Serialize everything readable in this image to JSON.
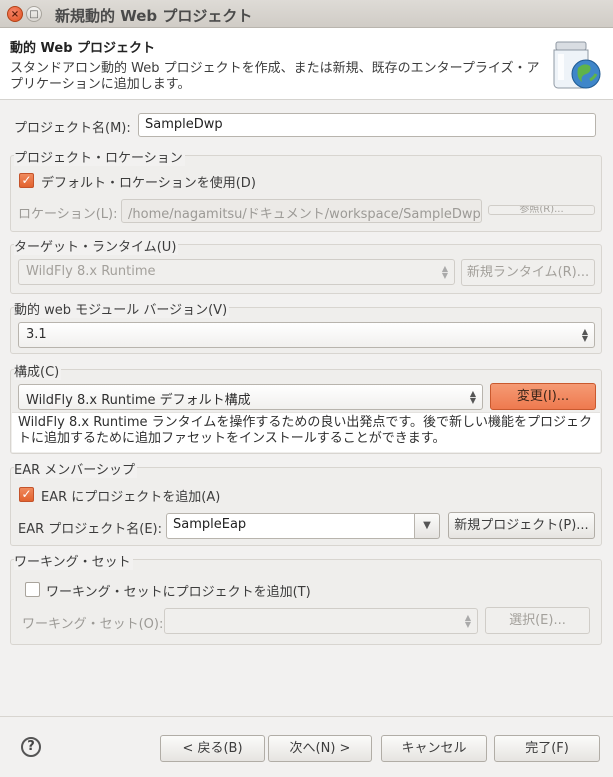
{
  "window": {
    "title": "新規動的 Web プロジェクト",
    "close_glyph": "×",
    "max_glyph": "□"
  },
  "banner": {
    "title": "動的 Web プロジェクト",
    "description": "スタンドアロン動的 Web プロジェクトを作成、または新規、既存のエンタープライズ・アプリケーションに追加します。",
    "icon": "web-project-jar-globe-icon"
  },
  "project_name": {
    "label": "プロジェクト名(M):",
    "value": "SampleDwp"
  },
  "location": {
    "group_title": "プロジェクト・ロケーション",
    "use_default_label": "デフォルト・ロケーションを使用(D)",
    "use_default_checked": true,
    "location_label": "ロケーション(L):",
    "location_value": "/home/nagamitsu/ドキュメント/workspace/SampleDwp",
    "browse_label": "参照(R)..."
  },
  "target_runtime": {
    "group_title": "ターゲット・ランタイム(U)",
    "selected": "WildFly 8.x Runtime",
    "new_runtime_label": "新規ランタイム(R)..."
  },
  "module_version": {
    "group_title": "動的 web モジュール バージョン(V)",
    "selected": "3.1"
  },
  "configuration": {
    "group_title": "構成(C)",
    "selected": "WildFly 8.x Runtime デフォルト構成",
    "modify_label": "変更(I)...",
    "description": "WildFly 8.x Runtime ランタイムを操作するための良い出発点です。後で新しい機能をプロジェクトに追加するために追加ファセットをインストールすることができます。"
  },
  "ear": {
    "group_title": "EAR メンバーシップ",
    "add_label": "EAR にプロジェクトを追加(A)",
    "add_checked": true,
    "project_name_label": "EAR プロジェクト名(E):",
    "project_name_value": "SampleEap",
    "new_project_label": "新規プロジェクト(P)..."
  },
  "working_set": {
    "group_title": "ワーキング・セット",
    "add_label": "ワーキング・セットにプロジェクトを追加(T)",
    "add_checked": false,
    "sets_label": "ワーキング・セット(O):",
    "sets_value": "",
    "select_label": "選択(E)..."
  },
  "footer": {
    "help_glyph": "?",
    "back_label": "< 戻る(B)",
    "next_label": "次へ(N) >",
    "cancel_label": "キャンセル",
    "finish_label": "完了(F)"
  },
  "colors": {
    "accent": "#ee7a4f",
    "background": "#f2f1f0"
  }
}
